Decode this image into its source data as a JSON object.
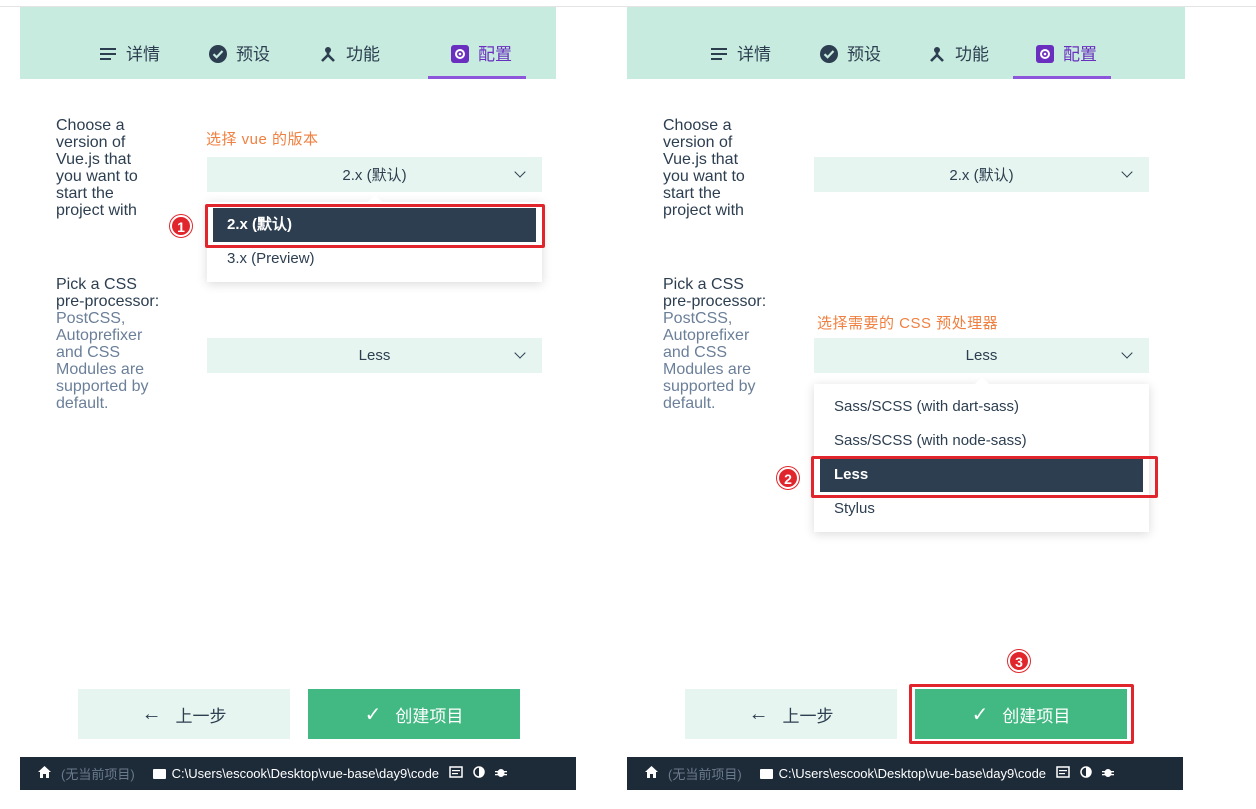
{
  "tabs": [
    {
      "label": "详情",
      "icon": "list-icon"
    },
    {
      "label": "预设",
      "icon": "check-circle-icon"
    },
    {
      "label": "功能",
      "icon": "merge-icon"
    },
    {
      "label": "配置",
      "icon": "settings-icon"
    }
  ],
  "vue_prompt": [
    "Choose a",
    "version of",
    "Vue.js that",
    "you want to",
    "start the",
    "project with"
  ],
  "css_prompt": {
    "lines": [
      "Pick a CSS",
      "pre-processor:"
    ],
    "muted_lines": [
      "PostCSS,",
      "Autoprefixer",
      "and CSS",
      "Modules are",
      "supported by",
      "default."
    ]
  },
  "left": {
    "hint": "选择 vue 的版本",
    "vue_select_value": "2.x (默认)",
    "vue_options": [
      "2.x (默认)",
      "3.x (Preview)"
    ],
    "css_select_value": "Less",
    "badge": "1"
  },
  "right": {
    "hint": "选择需要的 CSS 预处理器",
    "vue_select_value": "2.x (默认)",
    "css_select_value": "Less",
    "css_options": [
      "Sass/SCSS (with dart-sass)",
      "Sass/SCSS (with node-sass)",
      "Less",
      "Stylus"
    ],
    "badge_css": "2",
    "badge_create": "3"
  },
  "buttons": {
    "prev": "上一步",
    "create": "创建项目"
  },
  "statusbar": {
    "no_project": "(无当前项目)",
    "path": "C:\\Users\\escook\\Desktop\\vue-base\\day9\\code"
  },
  "colors": {
    "header_bg": "#c7ebde",
    "accent": "#42b983",
    "tab_active": "#8d55d9",
    "hint": "#f08041",
    "annotation_red": "#e0262c",
    "statusbar_bg": "#1d2a38"
  }
}
